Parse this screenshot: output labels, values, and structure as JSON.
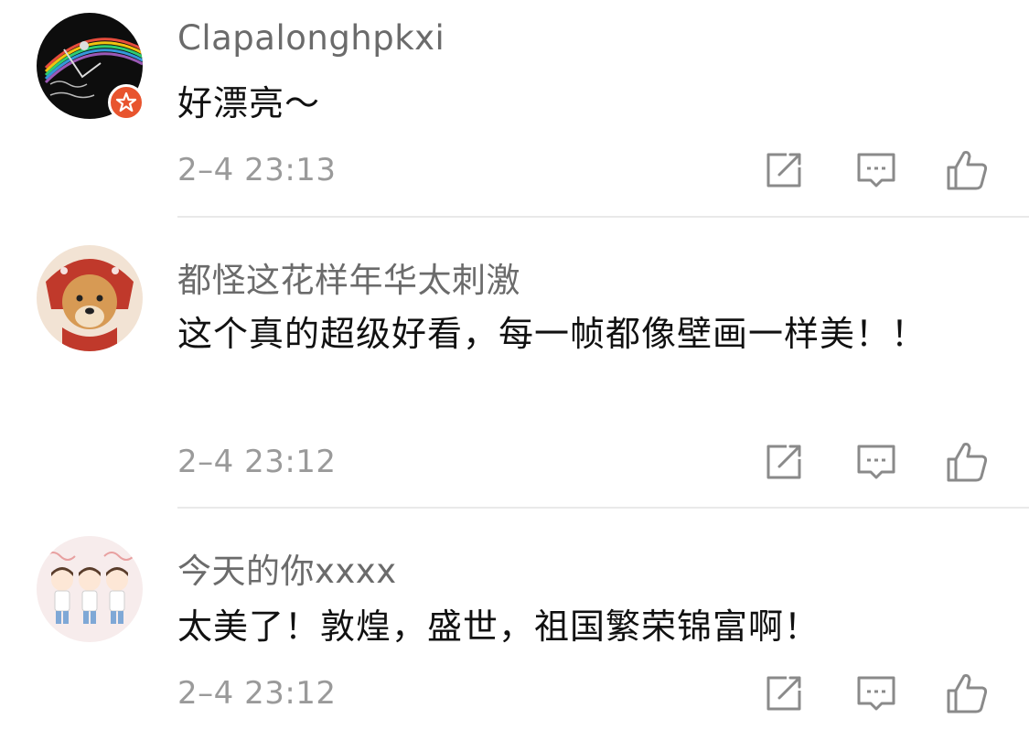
{
  "comments": [
    {
      "username": "Clapalonghpkxi",
      "text": "好漂亮～",
      "time": "2–4 23:13",
      "avatar": "ballet-of-china-icon",
      "verified_badge": true
    },
    {
      "username": "都怪这花样年华太刺激",
      "text": "这个真的超级好看，每一帧都像壁画一样美！！",
      "time": "2–4 23:12",
      "avatar": "dog-with-red-hood-icon",
      "verified_badge": false
    },
    {
      "username": "今天的你xxxx",
      "text": "太美了！敦煌，盛世，祖国繁荣锦富啊！",
      "time": "2–4 23:12",
      "avatar": "three-cartoon-boys-icon",
      "verified_badge": false
    }
  ],
  "action_icons": [
    "repost-icon",
    "reply-icon",
    "like-icon"
  ],
  "colors": {
    "username": "#6b6b6b",
    "text": "#111111",
    "time": "#9a9a9a",
    "icon": "#8a8a8a",
    "badge": "#e8542e",
    "divider": "#e9e9e9"
  }
}
